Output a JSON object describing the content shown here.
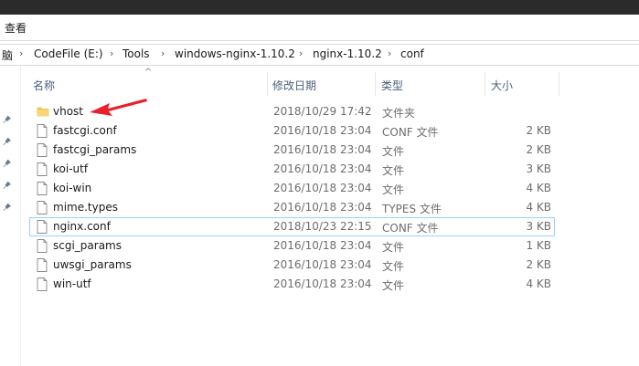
{
  "ribbon": {
    "tab_view": "查看"
  },
  "address": {
    "crumbs": [
      "脑",
      "CodeFile (E:)",
      "Tools",
      "windows-nginx-1.10.2",
      "nginx-1.10.2",
      "conf"
    ]
  },
  "columns": {
    "name": "名称",
    "modified": "修改日期",
    "type": "类型",
    "size": "大小"
  },
  "files": [
    {
      "name": "vhost",
      "date": "2018/10/29 17:42",
      "type": "文件夹",
      "size": "",
      "kind": "folder"
    },
    {
      "name": "fastcgi.conf",
      "date": "2016/10/18 23:04",
      "type": "CONF 文件",
      "size": "2 KB",
      "kind": "file"
    },
    {
      "name": "fastcgi_params",
      "date": "2016/10/18 23:04",
      "type": "文件",
      "size": "2 KB",
      "kind": "file"
    },
    {
      "name": "koi-utf",
      "date": "2016/10/18 23:04",
      "type": "文件",
      "size": "3 KB",
      "kind": "file"
    },
    {
      "name": "koi-win",
      "date": "2016/10/18 23:04",
      "type": "文件",
      "size": "4 KB",
      "kind": "file"
    },
    {
      "name": "mime.types",
      "date": "2016/10/18 23:04",
      "type": "TYPES 文件",
      "size": "4 KB",
      "kind": "file"
    },
    {
      "name": "nginx.conf",
      "date": "2018/10/23 22:15",
      "type": "CONF 文件",
      "size": "3 KB",
      "kind": "file",
      "selected": true
    },
    {
      "name": "scgi_params",
      "date": "2016/10/18 23:04",
      "type": "文件",
      "size": "1 KB",
      "kind": "file"
    },
    {
      "name": "uwsgi_params",
      "date": "2016/10/18 23:04",
      "type": "文件",
      "size": "2 KB",
      "kind": "file"
    },
    {
      "name": "win-utf",
      "date": "2016/10/18 23:04",
      "type": "文件",
      "size": "4 KB",
      "kind": "file"
    }
  ],
  "colors": {
    "arrow": "#e8202a",
    "folder": "#f5c94e",
    "selection_border": "#99d1ff",
    "header_text": "#4c607a"
  },
  "icons": {
    "folder": "folder-icon",
    "file": "file-icon",
    "pin": "pin-icon",
    "separator": "chevron-right-icon",
    "sort": "sort-up-icon"
  }
}
